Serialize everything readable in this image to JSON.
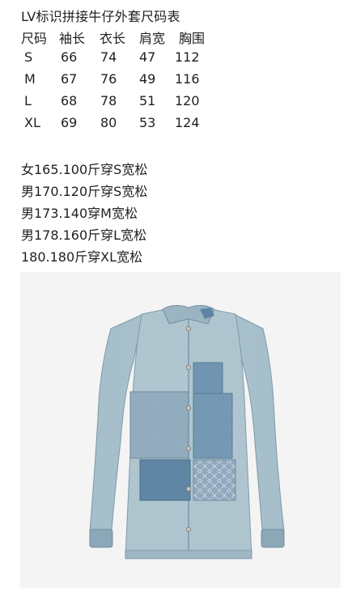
{
  "title": "LV标识拼接牛仔外套尺码表",
  "size_table": {
    "headers": [
      "尺码",
      "袖长",
      "衣长",
      "肩宽",
      "胸围"
    ],
    "rows": [
      [
        "S",
        "66",
        "74",
        "47",
        "112"
      ],
      [
        "M",
        "67",
        "76",
        "49",
        "116"
      ],
      [
        "L",
        "68",
        "78",
        "51",
        "120"
      ],
      [
        "XL",
        "69",
        "80",
        "53",
        "124"
      ]
    ]
  },
  "recommendations": [
    "女165.100斤穿S宽松",
    "男170.120斤穿S宽松",
    "男173.140穿M宽松",
    "男178.160斤穿L宽松",
    "180.180斤穿XL宽松"
  ],
  "product_photo": {
    "icon": "denim-jacket-image",
    "colors": {
      "background": "#f4f4f4",
      "denim_light": "#a9c1cb",
      "denim_mid": "#86a6b7",
      "denim_dark": "#5d84a3"
    }
  }
}
